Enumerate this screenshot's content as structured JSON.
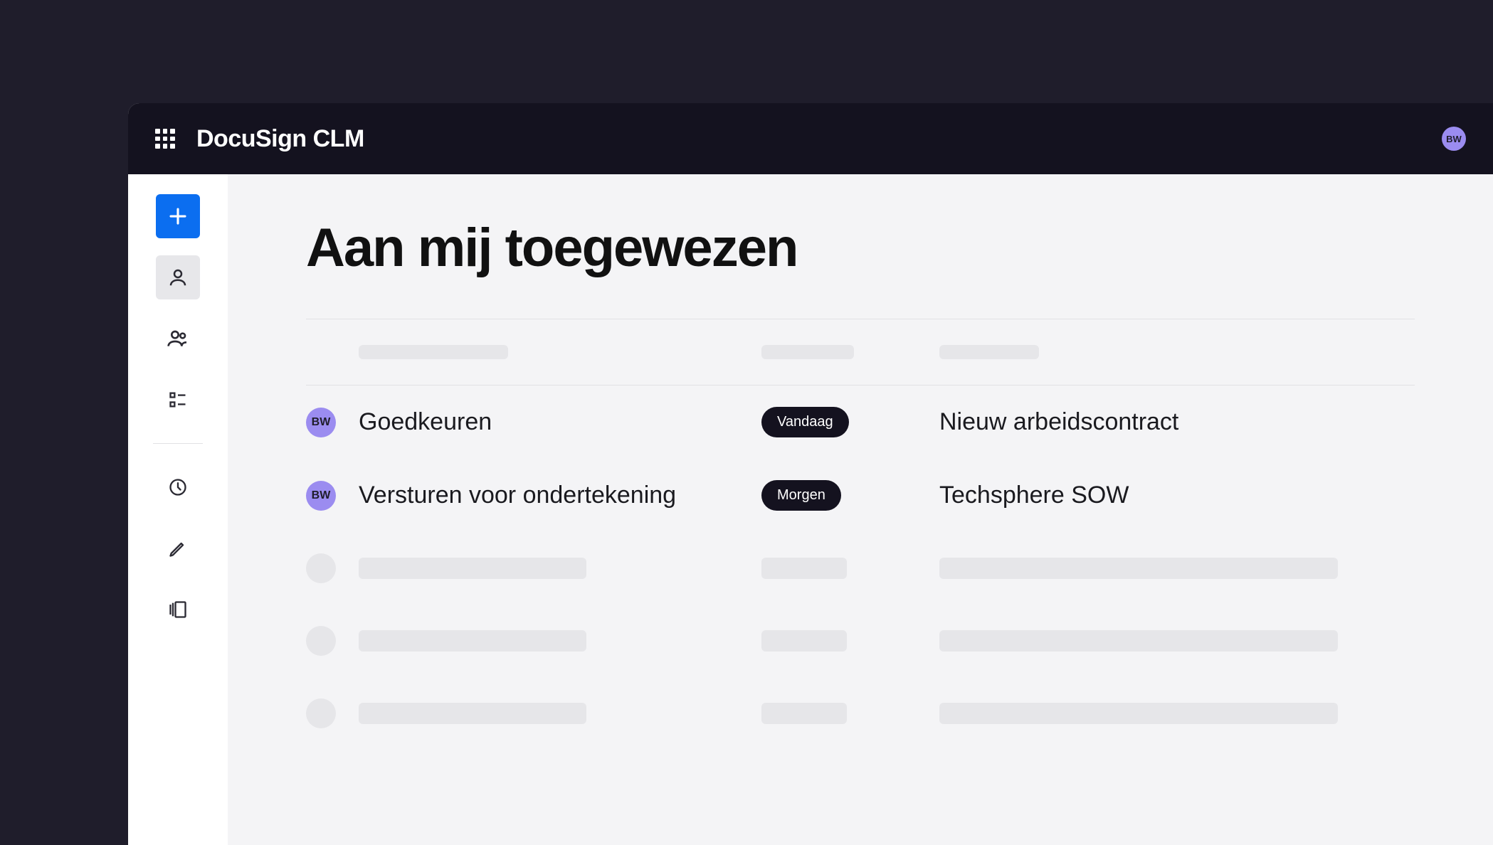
{
  "brand": {
    "name": "DocuSign",
    "product": "CLM"
  },
  "user": {
    "initials": "BW"
  },
  "page": {
    "title": "Aan mij toegewezen"
  },
  "rows": [
    {
      "avatar": "BW",
      "action": "Goedkeuren",
      "due": "Vandaag",
      "document": "Nieuw arbeidscontract"
    },
    {
      "avatar": "BW",
      "action": "Versturen voor ondertekening",
      "due": "Morgen",
      "document": "Techsphere SOW"
    }
  ]
}
